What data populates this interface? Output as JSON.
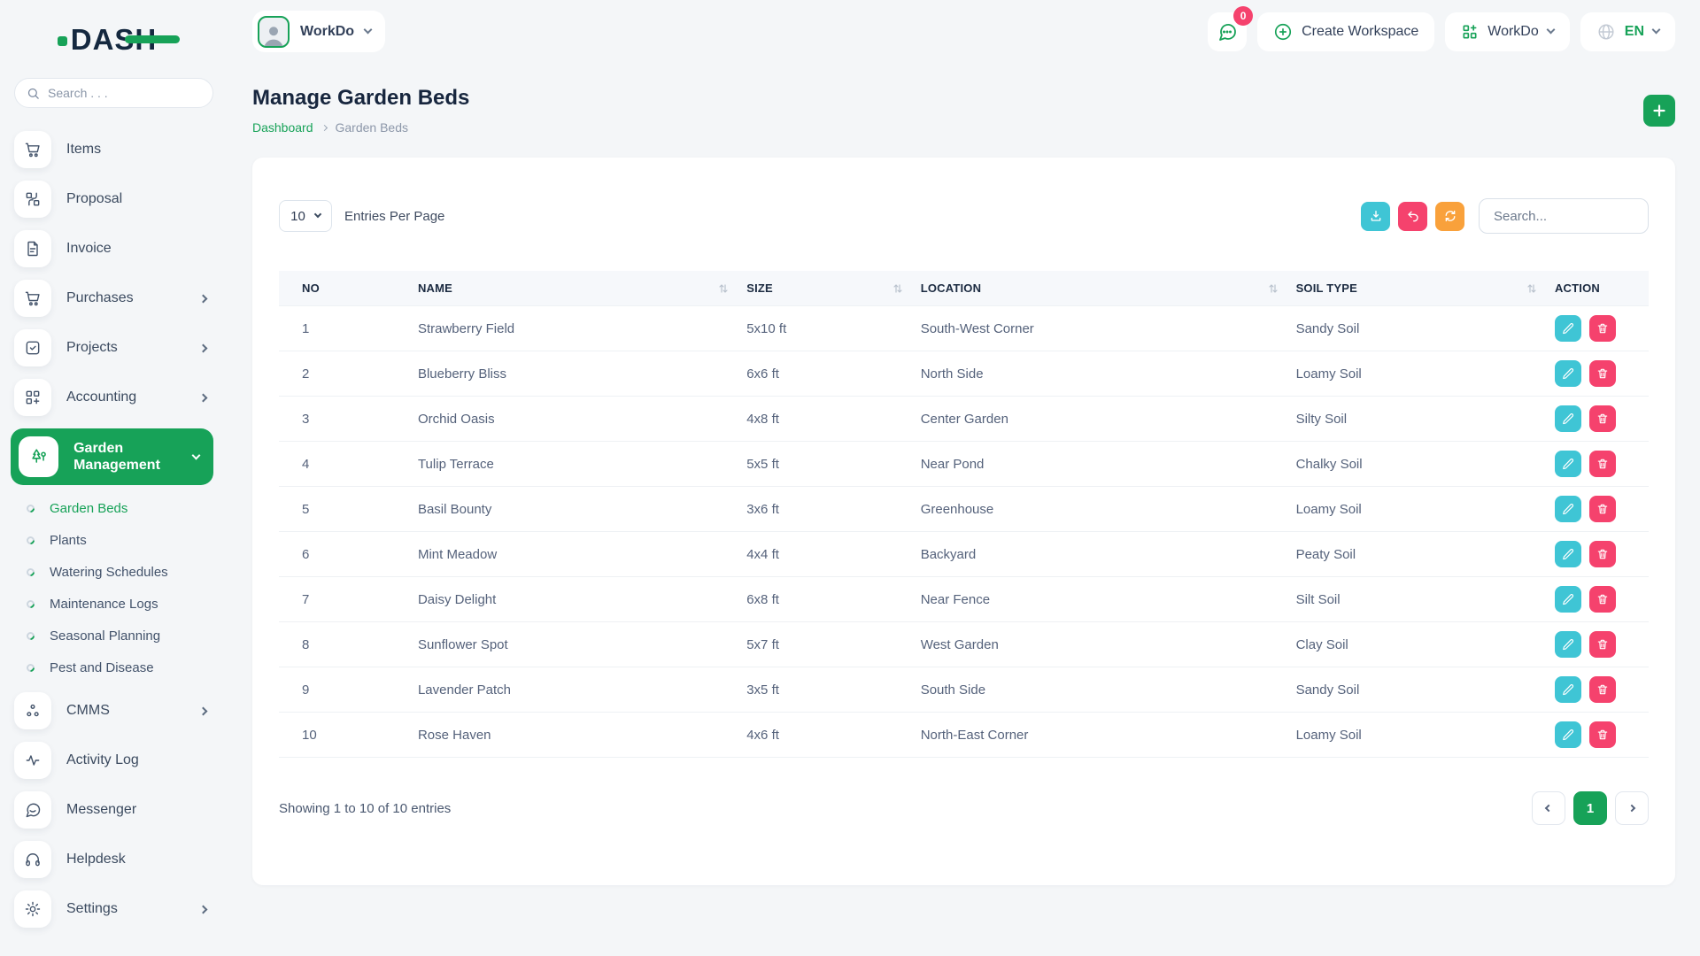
{
  "app": {
    "logo_text": "DASH"
  },
  "colors": {
    "accent_green": "#17a258",
    "danger_pink": "#f5426d",
    "info_teal": "#3fc5d5",
    "warning_orange": "#f9a13b"
  },
  "sidebar": {
    "search_placeholder": "Search . . .",
    "items": [
      {
        "label": "Items"
      },
      {
        "label": "Proposal"
      },
      {
        "label": "Invoice"
      },
      {
        "label": "Purchases"
      },
      {
        "label": "Projects"
      },
      {
        "label": "Accounting"
      },
      {
        "label": "Garden Management"
      },
      {
        "label": "CMMS"
      },
      {
        "label": "Activity Log"
      },
      {
        "label": "Messenger"
      },
      {
        "label": "Helpdesk"
      },
      {
        "label": "Settings"
      }
    ],
    "garden_submenu": [
      "Garden Beds",
      "Plants",
      "Watering Schedules",
      "Maintenance Logs",
      "Seasonal Planning",
      "Pest and Disease"
    ],
    "active_item": "Garden Management",
    "active_subitem": "Garden Beds"
  },
  "topbar": {
    "workspace_name": "WorkDo",
    "messages_badge": "0",
    "create_workspace_label": "Create Workspace",
    "workspace_switcher_label": "WorkDo",
    "language": "EN"
  },
  "page": {
    "title": "Manage Garden Beds",
    "breadcrumb": [
      "Dashboard",
      "Garden Beds"
    ]
  },
  "table": {
    "entries_per_page": "10",
    "entries_label": "Entries Per Page",
    "search_placeholder": "Search...",
    "columns": [
      "NO",
      "NAME",
      "SIZE",
      "LOCATION",
      "SOIL TYPE",
      "ACTION"
    ],
    "rows": [
      {
        "no": "1",
        "name": "Strawberry Field",
        "size": "5x10 ft",
        "location": "South-West Corner",
        "soil_type": "Sandy Soil"
      },
      {
        "no": "2",
        "name": "Blueberry Bliss",
        "size": "6x6 ft",
        "location": "North Side",
        "soil_type": "Loamy Soil"
      },
      {
        "no": "3",
        "name": "Orchid Oasis",
        "size": "4x8 ft",
        "location": "Center Garden",
        "soil_type": "Silty Soil"
      },
      {
        "no": "4",
        "name": "Tulip Terrace",
        "size": "5x5 ft",
        "location": "Near Pond",
        "soil_type": "Chalky Soil"
      },
      {
        "no": "5",
        "name": "Basil Bounty",
        "size": "3x6 ft",
        "location": "Greenhouse",
        "soil_type": "Loamy Soil"
      },
      {
        "no": "6",
        "name": "Mint Meadow",
        "size": "4x4 ft",
        "location": "Backyard",
        "soil_type": "Peaty Soil"
      },
      {
        "no": "7",
        "name": "Daisy Delight",
        "size": "6x8 ft",
        "location": "Near Fence",
        "soil_type": "Silt Soil"
      },
      {
        "no": "8",
        "name": "Sunflower Spot",
        "size": "5x7 ft",
        "location": "West Garden",
        "soil_type": "Clay Soil"
      },
      {
        "no": "9",
        "name": "Lavender Patch",
        "size": "3x5 ft",
        "location": "South Side",
        "soil_type": "Sandy Soil"
      },
      {
        "no": "10",
        "name": "Rose Haven",
        "size": "4x6 ft",
        "location": "North-East Corner",
        "soil_type": "Loamy Soil"
      }
    ],
    "footer_text": "Showing 1 to 10 of 10 entries",
    "current_page": "1"
  }
}
